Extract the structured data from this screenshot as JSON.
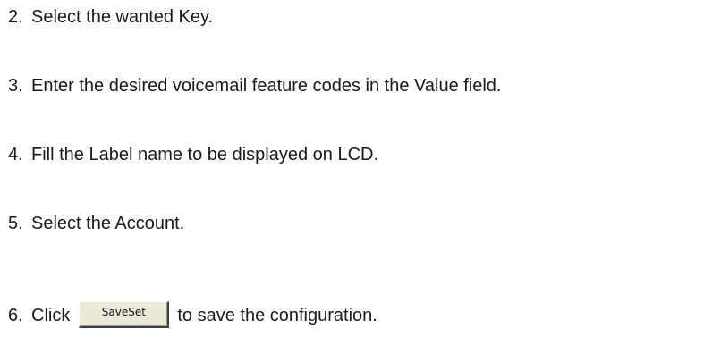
{
  "steps": [
    {
      "number": "2.",
      "text": "Select the wanted Key."
    },
    {
      "number": "3.",
      "text": "Enter the desired voicemail feature codes in the Value field."
    },
    {
      "number": "4.",
      "text": "Fill the Label name to be displayed on LCD."
    },
    {
      "number": "5.",
      "text": "Select the Account."
    },
    {
      "number": "6.",
      "text_before": "Click",
      "text_after": "to save the configuration."
    }
  ],
  "save_button": {
    "label": "SaveSet"
  }
}
